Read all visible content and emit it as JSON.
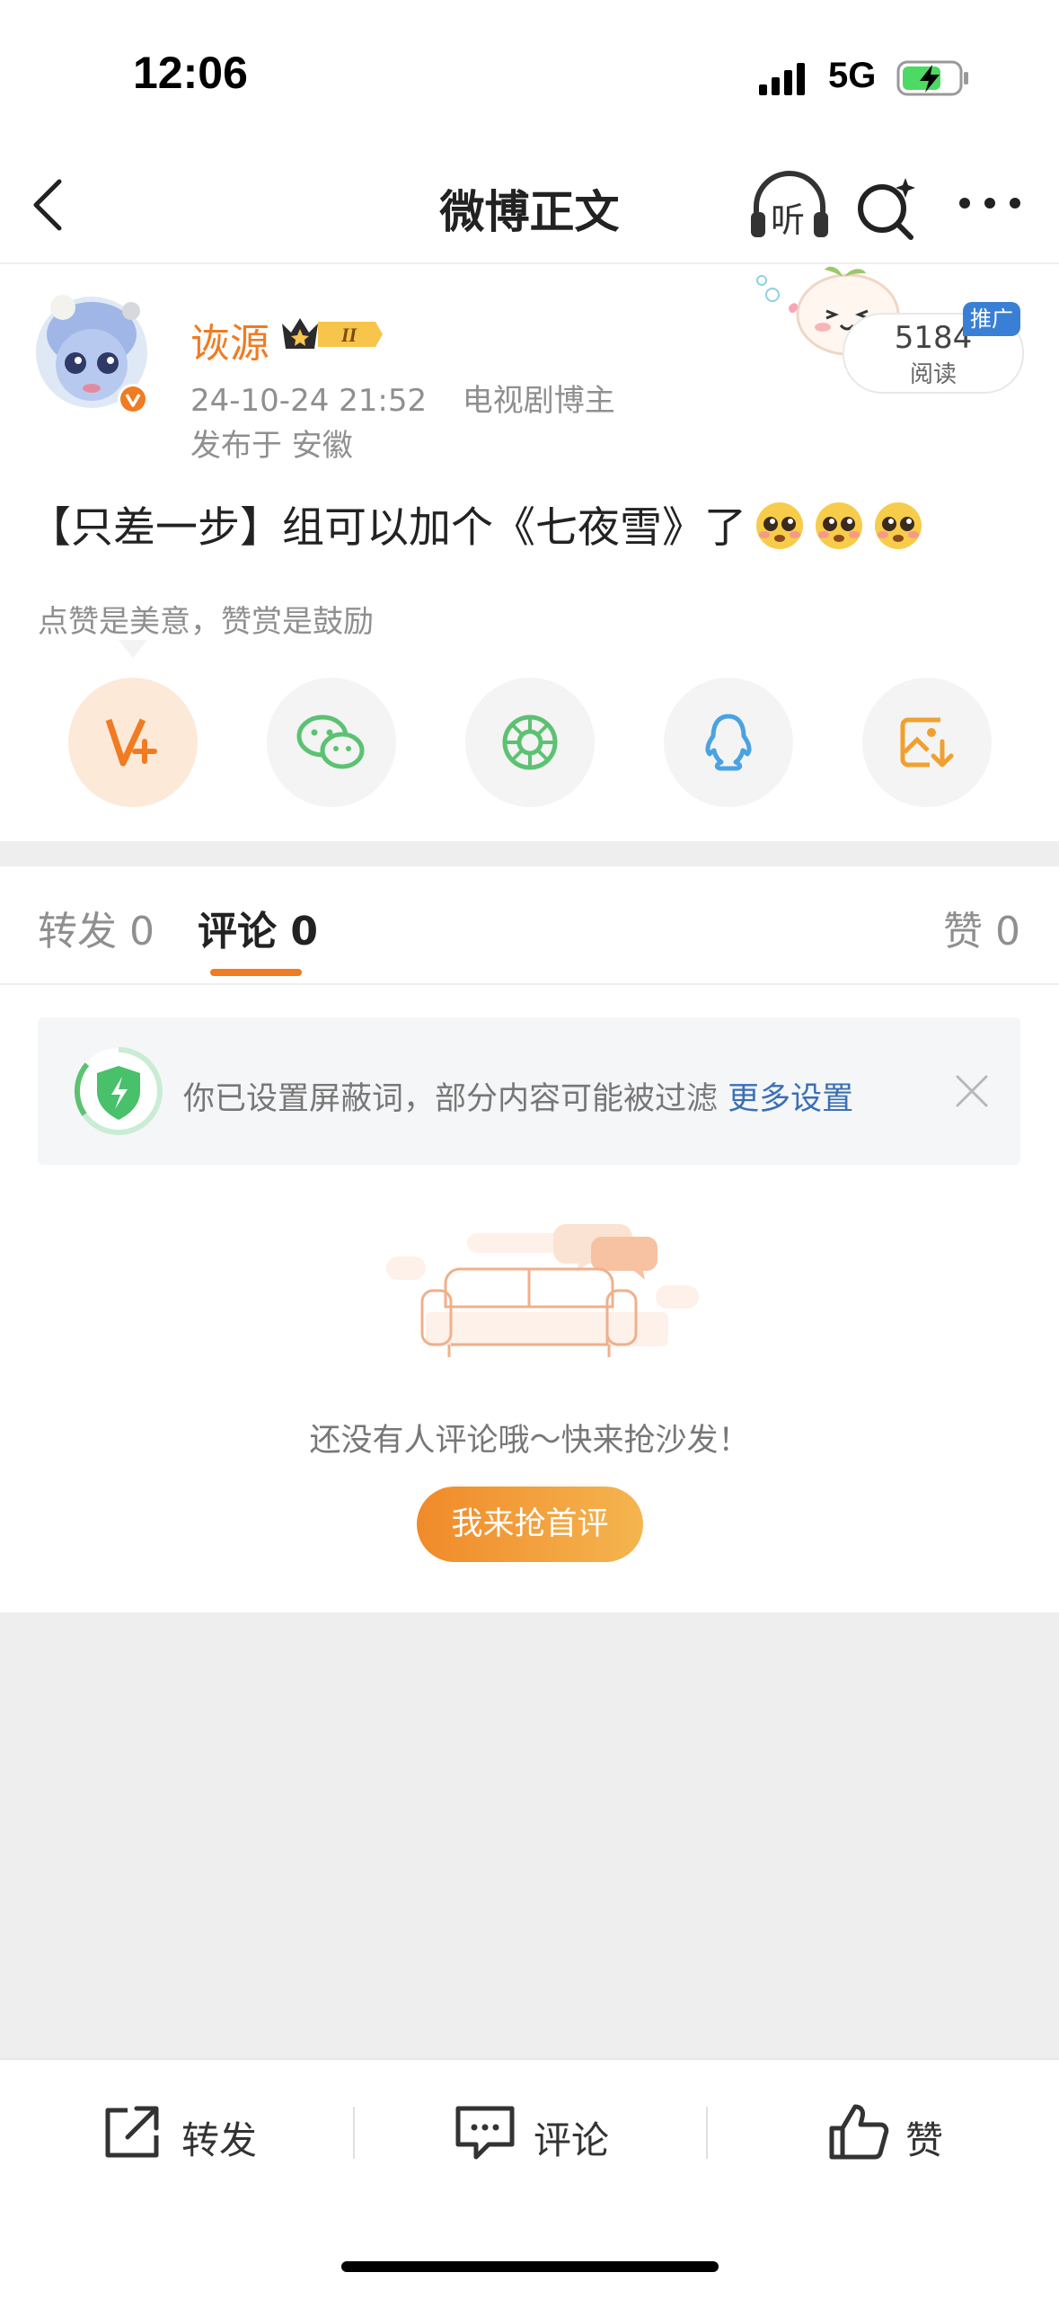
{
  "status_bar": {
    "time": "12:06",
    "network": "5G"
  },
  "nav": {
    "title": "微博正文",
    "listen_label": "听"
  },
  "post": {
    "username": "诙源",
    "date": "24-10-24 21:52",
    "tag": "电视剧博主",
    "location": "发布于 安徽",
    "reads": "5184",
    "reads_label": "阅读",
    "promo_badge": "推广",
    "text": "【只差一步】组可以加个《七夜雪》了",
    "reward_hint": "点赞是美意，赞赏是鼓励"
  },
  "tabs": {
    "repost": "转发 0",
    "comment": "评论 0",
    "like": "赞 0"
  },
  "notice": {
    "text": "你已设置屏蔽词，部分内容可能被过滤",
    "link": "更多设置"
  },
  "empty": {
    "text": "还没有人评论哦～快来抢沙发！",
    "button": "我来抢首评"
  },
  "bottom_bar": {
    "repost": "转发",
    "comment": "评论",
    "like": "赞"
  },
  "colors": {
    "accent": "#f07b22",
    "link": "#3a6fb5",
    "wechat": "#5cc272",
    "qq": "#4aa3e0"
  }
}
